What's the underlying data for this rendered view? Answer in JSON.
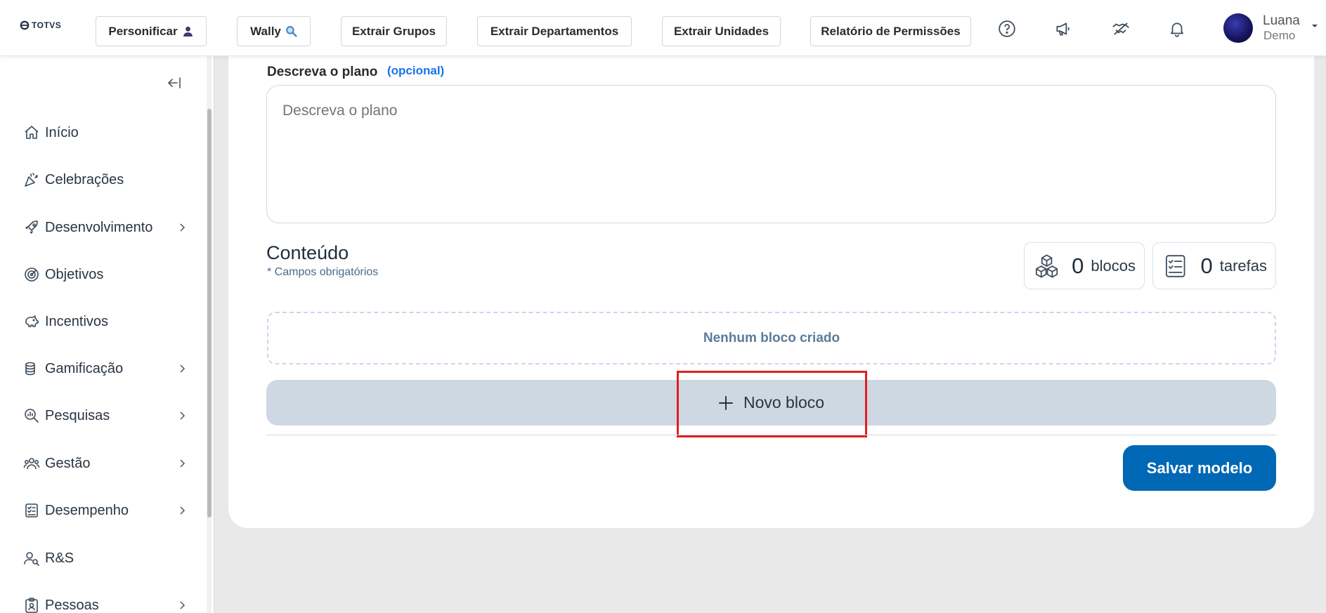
{
  "header": {
    "logo_text": "TOTVS",
    "buttons": [
      {
        "label": "Personificar",
        "icon": "person-icon"
      },
      {
        "label": "Wally",
        "icon": "magnifier-icon"
      },
      {
        "label": "Extrair Grupos"
      },
      {
        "label": "Extrair Departamentos"
      },
      {
        "label": "Extrair Unidades"
      },
      {
        "label": "Relatório de Permissões"
      }
    ],
    "icons": [
      "help-icon",
      "megaphone-icon",
      "handshake-icon",
      "bell-icon"
    ],
    "user": {
      "name": "Luana",
      "subtitle": "Demo"
    }
  },
  "sidebar": {
    "items": [
      {
        "label": "Início",
        "icon": "home-icon",
        "has_submenu": false
      },
      {
        "label": "Celebrações",
        "icon": "party-icon",
        "has_submenu": false
      },
      {
        "label": "Desenvolvimento",
        "icon": "rocket-icon",
        "has_submenu": true
      },
      {
        "label": "Objetivos",
        "icon": "target-icon",
        "has_submenu": false
      },
      {
        "label": "Incentivos",
        "icon": "piggy-bank-icon",
        "has_submenu": false
      },
      {
        "label": "Gamificação",
        "icon": "coins-icon",
        "has_submenu": true
      },
      {
        "label": "Pesquisas",
        "icon": "chart-search-icon",
        "has_submenu": true
      },
      {
        "label": "Gestão",
        "icon": "people-icon",
        "has_submenu": true
      },
      {
        "label": "Desempenho",
        "icon": "checklist-icon",
        "has_submenu": true
      },
      {
        "label": "R&S",
        "icon": "user-search-icon",
        "has_submenu": false
      },
      {
        "label": "Pessoas",
        "icon": "badge-icon",
        "has_submenu": true
      }
    ]
  },
  "form": {
    "description_label": "Descreva o plano",
    "optional_label": "(opcional)",
    "description_placeholder": "Descreva o plano",
    "content_title": "Conteúdo",
    "required_note": "* Campos obrigatórios",
    "stats": {
      "blocks": {
        "value": "0",
        "label": "blocos"
      },
      "tasks": {
        "value": "0",
        "label": "tarefas"
      }
    },
    "empty_message": "Nenhum bloco criado",
    "new_block_label": "Novo bloco",
    "save_label": "Salvar modelo"
  },
  "colors": {
    "primary": "#0068b5",
    "link": "#1a73e8",
    "highlight": "#e02020",
    "new_block_bg": "#ced8e2"
  }
}
